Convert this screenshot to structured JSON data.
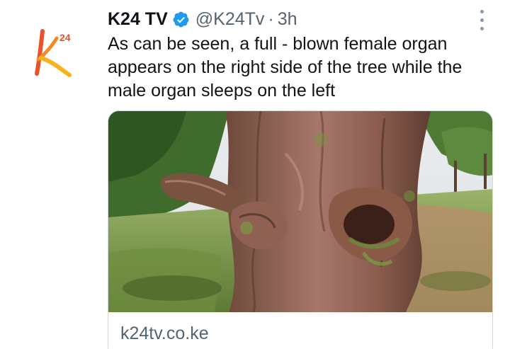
{
  "tweet": {
    "display_name": "K24 TV",
    "handle": "@K24Tv",
    "separator": "·",
    "time": "3h",
    "text": "As can be seen, a full - blown female organ appears on the right side of the tree while the male organ sleeps on the left",
    "avatar": {
      "icon": "k24-logo-icon",
      "logo_text": "K24"
    },
    "verified_icon": "verified-badge-icon",
    "more_icon": "more-options-icon"
  },
  "card": {
    "image_icon": "tree-trunk-photo",
    "domain": "k24tv.co.ke"
  },
  "colors": {
    "text_primary": "#0f1419",
    "text_secondary": "#536471",
    "verified_blue": "#1d9bf0",
    "logo_orange": "#e8542a",
    "logo_yellow": "#f5b41b",
    "card_border": "#cfd9de"
  }
}
